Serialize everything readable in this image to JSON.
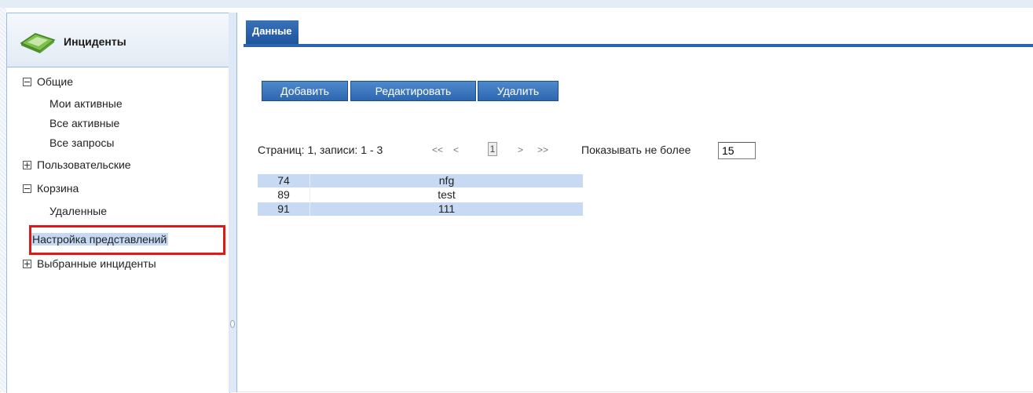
{
  "sidebar": {
    "title": "Инциденты",
    "tree": [
      {
        "label": "Общие",
        "expanded": true
      },
      {
        "label": "Мои активные"
      },
      {
        "label": "Все активные"
      },
      {
        "label": "Все запросы"
      },
      {
        "label": "Пользовательские",
        "expanded": false
      },
      {
        "label": "Корзина",
        "expanded": true
      },
      {
        "label": "Удаленные"
      },
      {
        "label": "Настройка представлений",
        "selected": true
      },
      {
        "label": "Выбранные инциденты",
        "expanded": false
      }
    ]
  },
  "main": {
    "tab_label": "Данные",
    "buttons": {
      "add": "Добавить",
      "edit": "Редактировать",
      "delete": "Удалить"
    },
    "pager": {
      "info": "Страниц: 1, записи: 1 - 3",
      "first": "<<",
      "prev": "<",
      "current_page": "1",
      "next": ">",
      "last": ">>",
      "show_label": "Показывать не более",
      "page_size": "15"
    },
    "rows": [
      {
        "id": "74",
        "name": "nfg"
      },
      {
        "id": "89",
        "name": "test"
      },
      {
        "id": "91",
        "name": "111"
      }
    ]
  },
  "colors": {
    "accent": "#2c64ad",
    "button": "#3a76c0",
    "selection": "#c5d9f4",
    "highlight_box": "#e01818",
    "row_alt": "#c7d9f3"
  }
}
